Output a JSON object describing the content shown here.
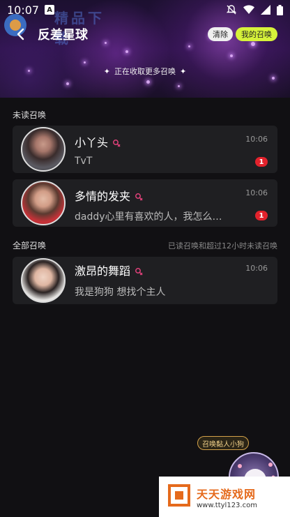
{
  "status_bar": {
    "time": "10:07",
    "a_icon": "A"
  },
  "top_bar": {
    "title": "反差星球",
    "clear_label": "清除",
    "my_summons_label": "我的召唤"
  },
  "collecting_text": "正在收取更多召唤",
  "unread_section": {
    "label": "未读召唤"
  },
  "all_section": {
    "label": "全部召唤",
    "note": "已读召唤和超过12小时未读召唤"
  },
  "unread_items": [
    {
      "name": "小丫头",
      "time": "10:06",
      "message": "TvT",
      "badge": "1"
    },
    {
      "name": "多情的发夹",
      "time": "10:06",
      "message": "daddy心里有喜欢的人，我怎么…",
      "badge": "1"
    }
  ],
  "all_items": [
    {
      "name": "激昂的舞蹈",
      "time": "10:06",
      "message": "我是狗狗 想找个主人"
    }
  ],
  "floating": {
    "tag": "召唤黏人小狗"
  },
  "watermark": {
    "title": "天天游戏网",
    "url": "www.ttyl123.com",
    "top_text": "精品下载"
  },
  "colors": {
    "accent_green": "#d6f23a",
    "badge_red": "#e2222c",
    "female_pink": "#e0417a"
  }
}
